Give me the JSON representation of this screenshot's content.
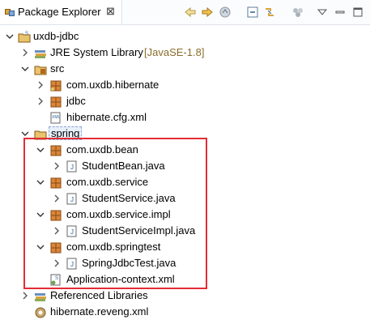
{
  "view": {
    "title": "Package Explorer",
    "close_symbol": "⊠",
    "toolbar_icons": [
      "back-arrow-icon",
      "forward-arrow-icon",
      "up-folder-icon",
      "collapse-all-icon",
      "link-with-editor-icon",
      "filters-icon",
      "view-menu-icon",
      "minimize-icon",
      "maximize-icon"
    ]
  },
  "tree": {
    "project": "uxdb-jdbc",
    "jre": {
      "label": "JRE System Library",
      "decoration": "[JavaSE-1.8]"
    },
    "src": "src",
    "pkg_hibernate": "com.uxdb.hibernate",
    "pkg_jdbc": "jdbc",
    "hibernate_cfg": "hibernate.cfg.xml",
    "spring": "spring",
    "pkg_bean": "com.uxdb.bean",
    "file_studentbean": "StudentBean.java",
    "pkg_service": "com.uxdb.service",
    "file_studentservice": "StudentService.java",
    "pkg_service_impl": "com.uxdb.service.impl",
    "file_studentservice_impl": "StudentServiceImpl.java",
    "pkg_springtest": "com.uxdb.springtest",
    "file_springjdbctest": "SpringJdbcTest.java",
    "app_context": "Application-context.xml",
    "referenced_libs": "Referenced Libraries",
    "hibernate_reveng": "hibernate.reveng.xml"
  },
  "colors": {
    "highlight_box": "#e42c35",
    "decoration_text": "#8a6d2b",
    "package_icon": "#b5651d"
  }
}
